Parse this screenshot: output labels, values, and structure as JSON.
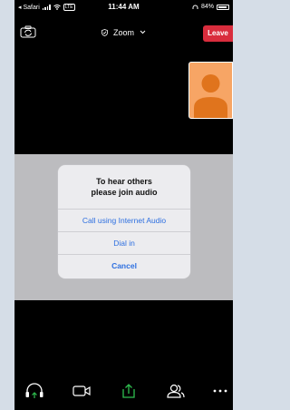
{
  "status_bar": {
    "back_app": "◂ Safari",
    "time": "11:44 AM",
    "network_badge": "LTE",
    "battery": "84%"
  },
  "top_bar": {
    "title": "Zoom",
    "leave_label": "Leave"
  },
  "dialog": {
    "title_line1": "To hear others",
    "title_line2": "please join audio",
    "options": [
      {
        "label": "Call using Internet Audio"
      },
      {
        "label": "Dial in"
      },
      {
        "label": "Cancel"
      }
    ]
  },
  "toolbar": {
    "icons": [
      "join-audio-icon",
      "video-icon",
      "share-icon",
      "participants-icon",
      "more-icon"
    ]
  },
  "colors": {
    "leave": "#d92d3d",
    "accent": "#2d6fe0",
    "share": "#2fbe4f",
    "avatar_bg": "#f7a565",
    "avatar_fg": "#e0741d"
  }
}
